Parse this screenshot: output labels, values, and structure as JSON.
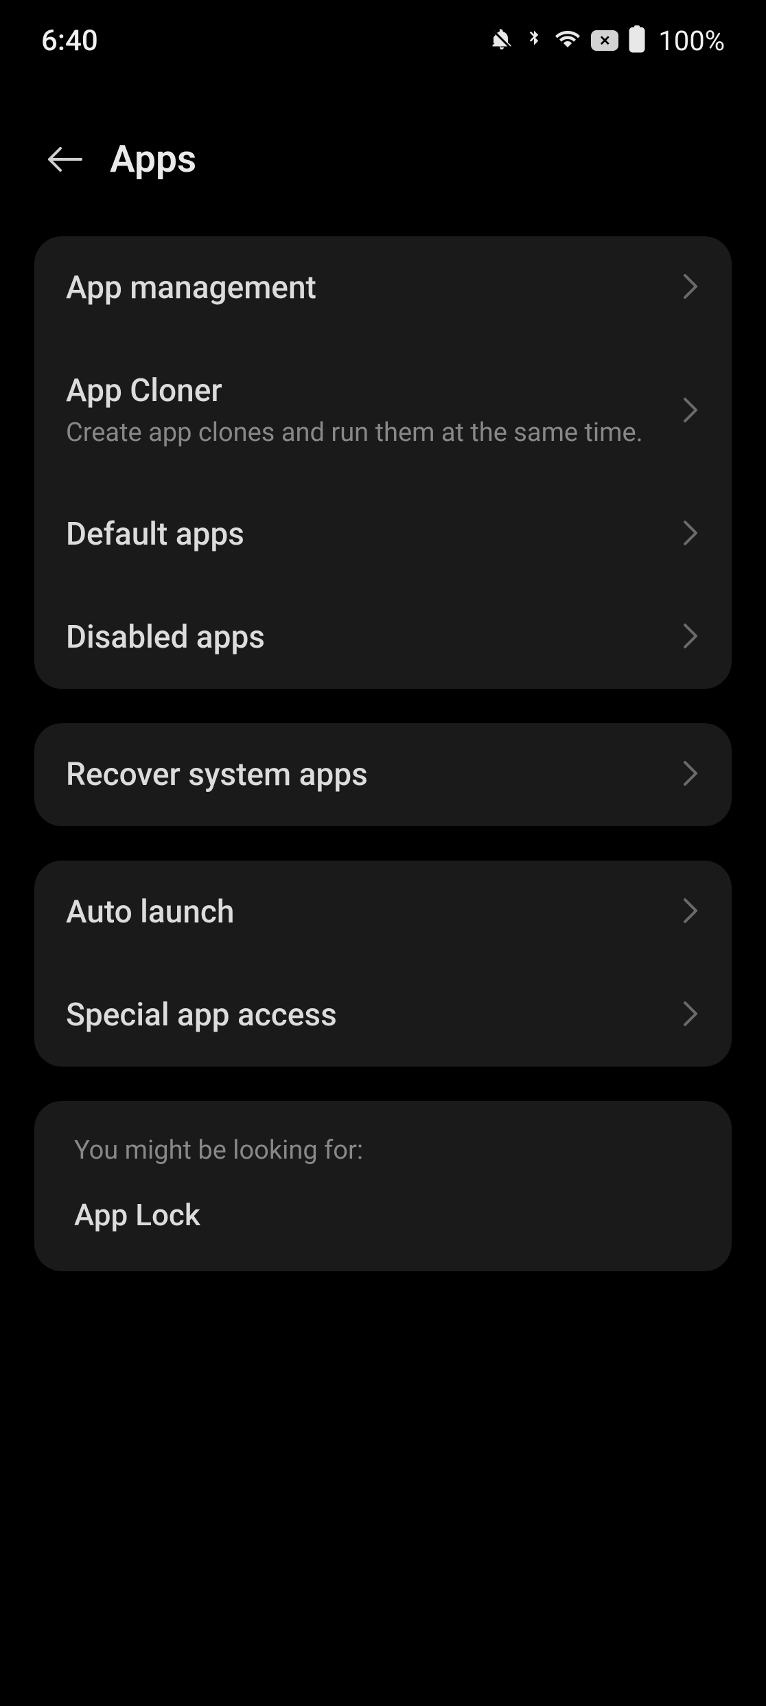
{
  "status_bar": {
    "time": "6:40",
    "battery_percent": "100%"
  },
  "header": {
    "title": "Apps"
  },
  "groups": [
    {
      "items": [
        {
          "title": "App management",
          "subtitle": null
        },
        {
          "title": "App Cloner",
          "subtitle": "Create app clones and run them at the same time."
        },
        {
          "title": "Default apps",
          "subtitle": null
        },
        {
          "title": "Disabled apps",
          "subtitle": null
        }
      ]
    },
    {
      "items": [
        {
          "title": "Recover system apps",
          "subtitle": null
        }
      ]
    },
    {
      "items": [
        {
          "title": "Auto launch",
          "subtitle": null
        },
        {
          "title": "Special app access",
          "subtitle": null
        }
      ]
    }
  ],
  "suggestion": {
    "label": "You might be looking for:",
    "item": "App Lock"
  }
}
